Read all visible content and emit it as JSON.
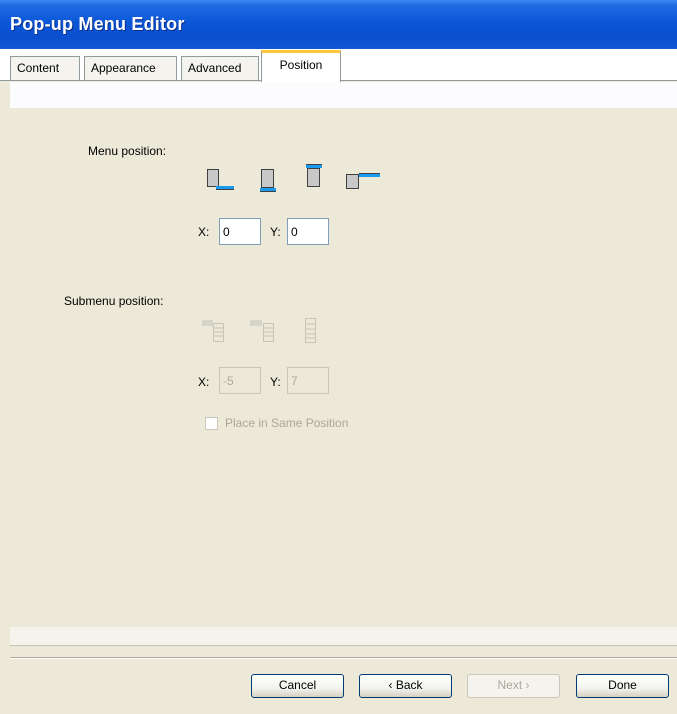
{
  "window": {
    "title": "Pop-up Menu Editor"
  },
  "tabs": [
    {
      "label": "Content",
      "active": false
    },
    {
      "label": "Appearance",
      "active": false
    },
    {
      "label": "Advanced",
      "active": false
    },
    {
      "label": "Position",
      "active": true
    }
  ],
  "menu_position": {
    "label": "Menu position:",
    "x_label": "X:",
    "x_value": "0",
    "y_label": "Y:",
    "y_value": "0",
    "icons": [
      "position-below-left-icon",
      "position-below-icon",
      "position-above-icon",
      "position-right-icon"
    ]
  },
  "submenu_position": {
    "label": "Submenu position:",
    "x_label": "X:",
    "x_value": "-5",
    "y_label": "Y:",
    "y_value": "7",
    "checkbox_label": "Place in Same Position",
    "checkbox_checked": false,
    "enabled": false,
    "icons": [
      "submenu-top-right-icon",
      "submenu-right-icon",
      "submenu-below-icon"
    ]
  },
  "buttons": {
    "cancel": "Cancel",
    "back": "‹ Back",
    "next": "Next ›",
    "done": "Done"
  },
  "colors": {
    "title_bar": "#0b57d8",
    "active_tab_accent": "#ffc83d",
    "highlight_bar": "#1a9bf0",
    "dialog_face": "#ece9d8"
  }
}
